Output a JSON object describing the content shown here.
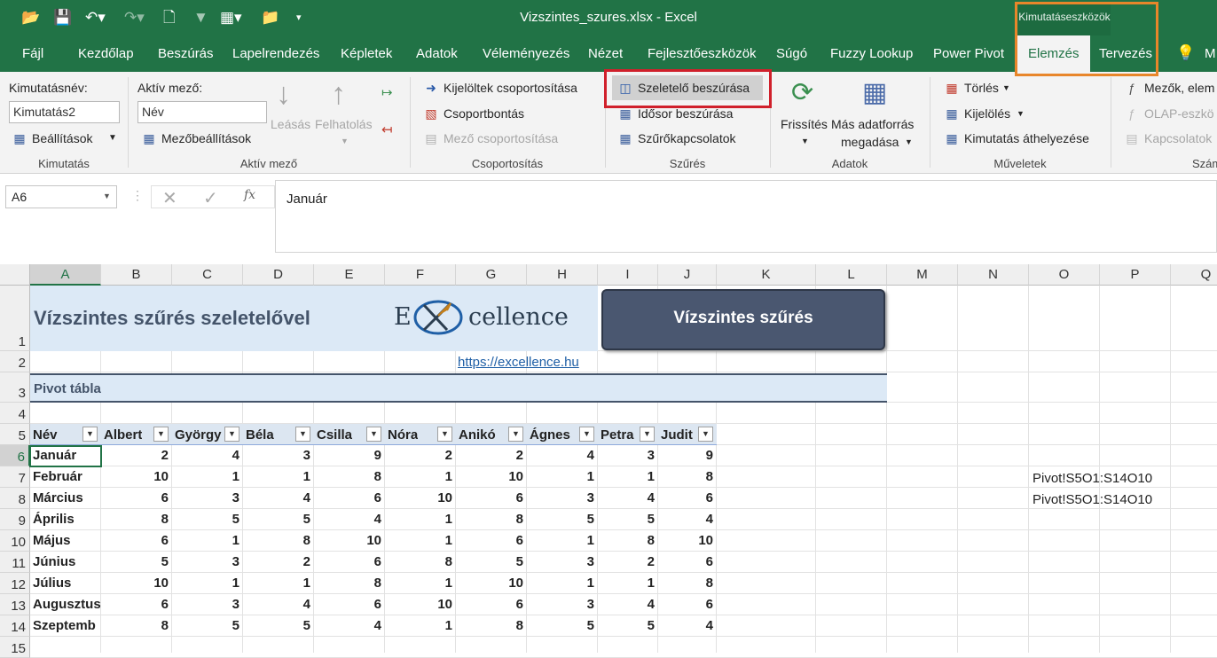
{
  "qat": {
    "open_icon": "folder-open-icon",
    "save_icon": "save-icon",
    "undo_icon": "undo-icon",
    "redo_icon": "redo-icon",
    "new_icon": "new-doc-icon",
    "filter_icon": "filter-icon",
    "table_icon": "table-icon",
    "folder_icon": "folder-icon",
    "more_icon": "customize-qat-icon"
  },
  "title": "Vizszintes_szures.xlsx  -  Excel",
  "context_group": "Kimutatáseszközök",
  "tabs": [
    "Fájl",
    "Kezdőlap",
    "Beszúrás",
    "Lapelrendezés",
    "Képletek",
    "Adatok",
    "Véleményezés",
    "Nézet",
    "Fejlesztőeszközök",
    "Súgó",
    "Fuzzy Lookup",
    "Power Pivot",
    "Elemzés",
    "Tervezés"
  ],
  "help_icon": "lightbulb-icon",
  "tab_more": "M",
  "ribbon": {
    "kimutatas": {
      "name_label": "Kimutatásnév:",
      "name_value": "Kimutatás2",
      "settings": "Beállítások",
      "group": "Kimutatás"
    },
    "aktiv": {
      "label": "Aktív mező:",
      "value": "Név",
      "field_settings": "Mezőbeállítások",
      "drill_down": "Leásás",
      "drill_up": "Felhatolás",
      "group": "Aktív mező"
    },
    "csoport": {
      "group_selection": "Kijelöltek csoportosítása",
      "ungroup": "Csoportbontás",
      "group_field": "Mező csoportosítása",
      "group": "Csoportosítás"
    },
    "szures": {
      "insert_slicer": "Szeletelő beszúrása",
      "insert_timeline": "Idősor beszúrása",
      "filter_connections": "Szűrőkapcsolatok",
      "group": "Szűrés"
    },
    "adatok": {
      "refresh": "Frissítés",
      "change_source_1": "Más adatforrás",
      "change_source_2": "megadása",
      "group": "Adatok"
    },
    "muveletek": {
      "clear": "Törlés",
      "select": "Kijelölés",
      "move": "Kimutatás áthelyezése",
      "group": "Műveletek"
    },
    "szamitasok": {
      "fields": "Mezők, elem",
      "olap": "OLAP-eszkö",
      "relationships": "Kapcsolatok",
      "group": "Szám"
    }
  },
  "formula": {
    "cell_ref": "A6",
    "fx": "fx",
    "value": "Január"
  },
  "columns": [
    "A",
    "B",
    "C",
    "D",
    "E",
    "F",
    "G",
    "H",
    "I",
    "J",
    "K",
    "L",
    "M",
    "N",
    "O",
    "P",
    "Q"
  ],
  "rows": [
    "1",
    "2",
    "3",
    "4",
    "5",
    "6",
    "7",
    "8",
    "9",
    "10",
    "11",
    "12",
    "13",
    "14",
    "15"
  ],
  "sheet": {
    "title": "Vízszintes szűrés szeletelővel",
    "logo": "Excellence",
    "logo_e": "E",
    "logo_rest": "cellence",
    "url": "https://excellence.hu",
    "button_label": "Vízszintes szűrés",
    "section": "Pivot tábla",
    "header": [
      "Név",
      "Albert",
      "György",
      "Béla",
      "Csilla",
      "Nóra",
      "Anikó",
      "Ágnes",
      "Petra",
      "Judit"
    ],
    "months": [
      "Január",
      "Február",
      "Március",
      "Április",
      "Május",
      "Június",
      "Július",
      "Augusztus",
      "Szeptemb"
    ],
    "values": [
      [
        2,
        4,
        3,
        9,
        2,
        2,
        4,
        3,
        9
      ],
      [
        10,
        1,
        1,
        8,
        1,
        10,
        1,
        1,
        8
      ],
      [
        6,
        3,
        4,
        6,
        10,
        6,
        3,
        4,
        6
      ],
      [
        8,
        5,
        5,
        4,
        1,
        8,
        5,
        5,
        4
      ],
      [
        6,
        1,
        8,
        10,
        1,
        6,
        1,
        8,
        10
      ],
      [
        5,
        3,
        2,
        6,
        8,
        5,
        3,
        2,
        6
      ],
      [
        10,
        1,
        1,
        8,
        1,
        10,
        1,
        1,
        8
      ],
      [
        6,
        3,
        4,
        6,
        10,
        6,
        3,
        4,
        6
      ],
      [
        8,
        5,
        5,
        4,
        1,
        8,
        5,
        5,
        4
      ]
    ],
    "ref_o7": "Pivot!S5O1:S14O10",
    "ref_o8": "Pivot!S5O1:S14O10"
  },
  "colors": {
    "excel_green": "#217346",
    "highlight_red": "#d0202b",
    "context_orange": "#e8862a",
    "title_fill": "#dce9f6",
    "title_text": "#44546a",
    "button_fill": "#4a5770"
  }
}
